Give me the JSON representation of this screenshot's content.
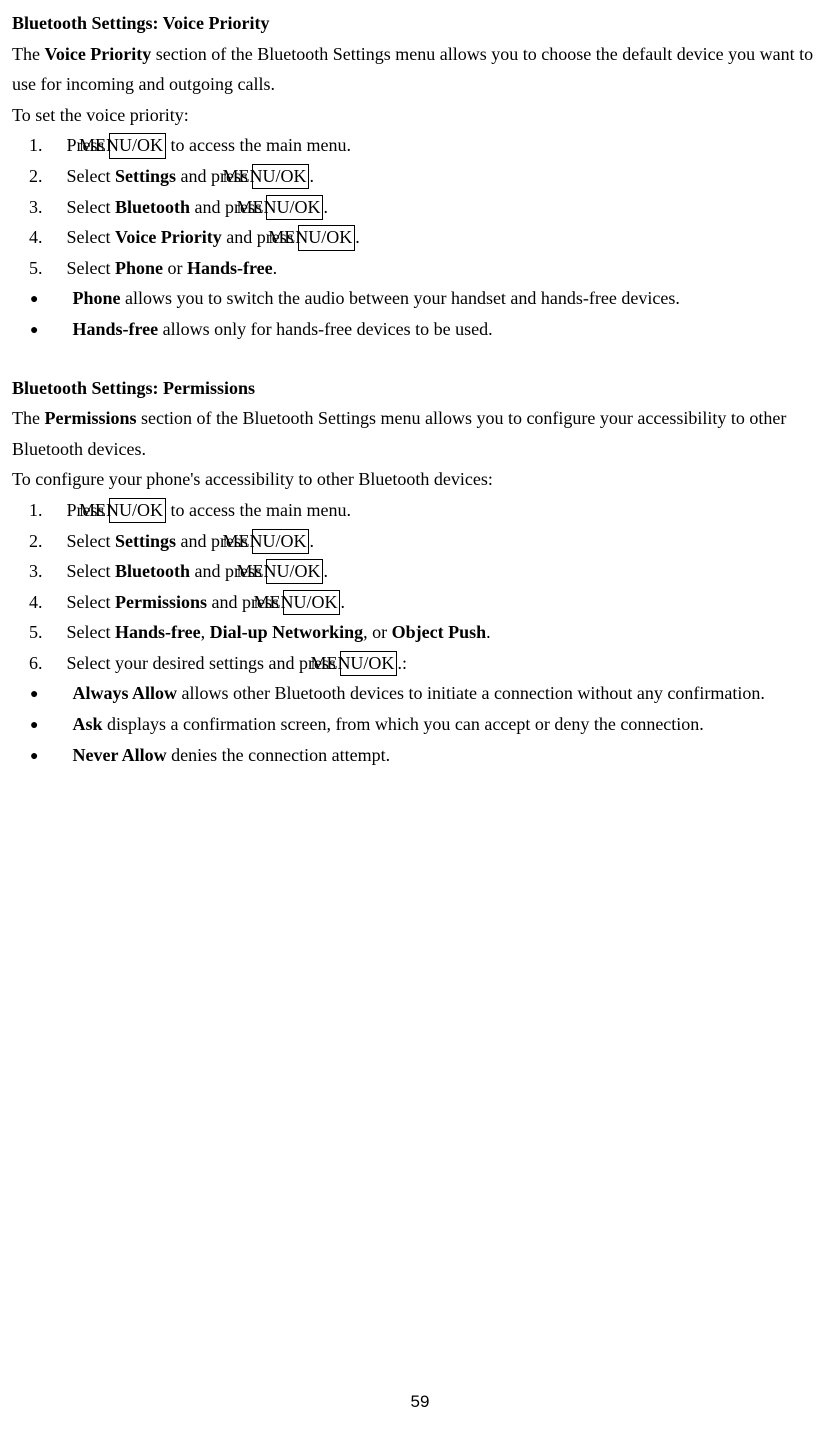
{
  "section1": {
    "title": "Bluetooth Settings: Voice Priority",
    "intro_pre": "The ",
    "intro_bold": "Voice Priority",
    "intro_post": " section of the Bluetooth Settings menu allows you to choose the default device you want to use for incoming and outgoing calls.",
    "lead": "To set the voice priority:",
    "steps": [
      {
        "num": "1",
        "pre": "Press ",
        "box": "MENU/OK",
        "post": " to access the main menu."
      },
      {
        "num": "2",
        "pre": "Select ",
        "bold": "Settings",
        "mid": " and press ",
        "box": "MENU/OK",
        "post": "."
      },
      {
        "num": "3",
        "pre": "Select ",
        "bold": "Bluetooth",
        "mid": " and press ",
        "box": "MENU/OK",
        "post": "."
      },
      {
        "num": "4",
        "pre": "Select ",
        "bold": "Voice Priority",
        "mid": " and press ",
        "box": "MENU/OK",
        "post": "."
      },
      {
        "num": "5",
        "pre": "Select ",
        "bold1": "Phone",
        "mid": " or ",
        "bold2": "Hands-free",
        "post": "."
      }
    ],
    "bullets": [
      {
        "bold": "Phone",
        "text": " allows you to switch the audio between your handset and hands-free devices."
      },
      {
        "bold": "Hands-free",
        "text": " allows only for hands-free devices to be used."
      }
    ]
  },
  "section2": {
    "title": "Bluetooth Settings: Permissions",
    "intro_pre": "The ",
    "intro_bold": "Permissions",
    "intro_post": " section of the Bluetooth Settings menu allows you to configure your accessibility to other Bluetooth devices.",
    "lead": "To configure your phone's accessibility to other Bluetooth devices:",
    "steps": [
      {
        "num": "1",
        "pre": "Press ",
        "box": "MENU/OK",
        "post": " to access the main menu."
      },
      {
        "num": "2",
        "pre": "Select ",
        "bold": "Settings",
        "mid": " and press ",
        "box": "MENU/OK",
        "post": "."
      },
      {
        "num": "3",
        "pre": "Select ",
        "bold": "Bluetooth",
        "mid": " and press ",
        "box": "MENU/OK",
        "post": "."
      },
      {
        "num": "4",
        "pre": "Select ",
        "bold": "Permissions",
        "mid": " and press ",
        "box": "MENU/OK",
        "post": "."
      },
      {
        "num": "5",
        "pre": "Select ",
        "bold1": "Hands-free",
        "sep1": ", ",
        "bold2": "Dial-up Networking",
        "sep2": ", or ",
        "bold3": "Object Push",
        "post": "."
      },
      {
        "num": "6",
        "pre": "Select your desired settings and press ",
        "box": "MENU/OK",
        "post": ".:"
      }
    ],
    "bullets": [
      {
        "bold": "Always Allow",
        "text": " allows other Bluetooth devices to initiate a connection without any confirmation."
      },
      {
        "bold": "Ask",
        "text": " displays a confirmation screen, from which you can accept or deny the connection."
      },
      {
        "bold": "Never Allow",
        "text": " denies the connection attempt."
      }
    ]
  },
  "page_number": "59"
}
